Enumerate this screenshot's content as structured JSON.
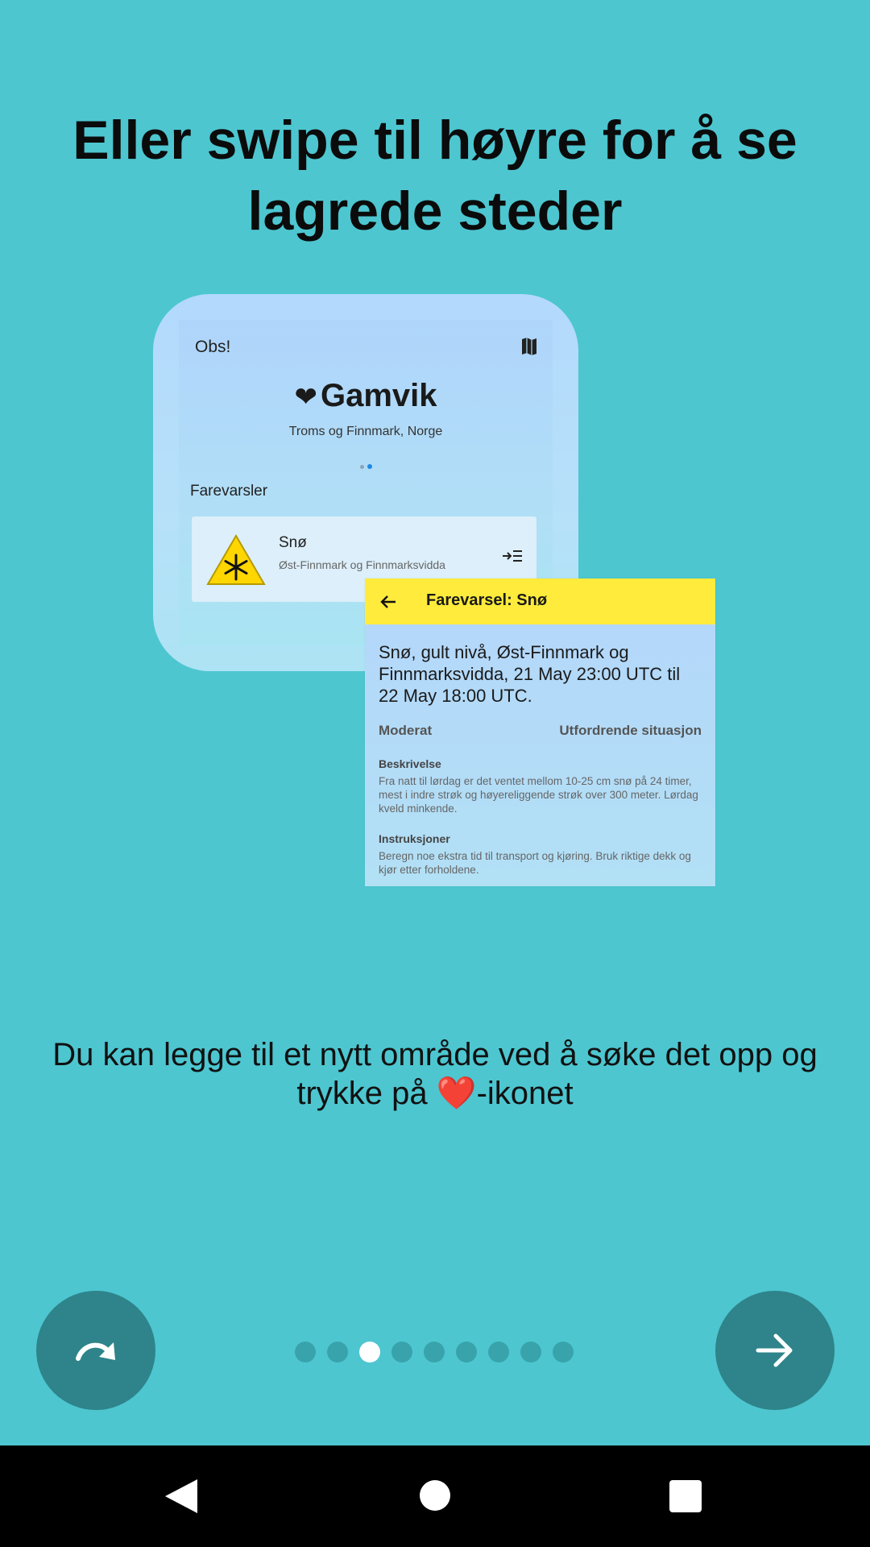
{
  "title": "Eller swipe til høyre for å se lagrede steder",
  "illustration": {
    "location_card": {
      "obs_label": "Obs!",
      "map_icon": "map-icon",
      "heart_symbol": "❤",
      "location_name": "Gamvik",
      "region": "Troms og Finnmark, Norge",
      "section_label": "Farevarsler",
      "warning": {
        "icon": "snowflake-warning-icon",
        "title": "Snø",
        "area": "Øst-Finnmark og Finnmarksvidda"
      }
    },
    "detail_card": {
      "bar_title": "Farevarsel: Snø",
      "headline": "Snø, gult nivå, Øst-Finnmark og Finnmarksvidda, 21 May 23:00 UTC til 22 May 18:00 UTC.",
      "level_left": "Moderat",
      "level_right": "Utfordrende situasjon",
      "description_heading": "Beskrivelse",
      "description_text": "Fra natt til lørdag er det ventet mellom 10-25 cm snø på 24 timer, mest i indre strøk og høyereliggende strøk over 300 meter. Lørdag kveld minkende.",
      "instructions_heading": "Instruksjoner",
      "instructions_text": "Beregn noe ekstra tid til transport og kjøring. Bruk riktige dekk og kjør etter forholdene."
    }
  },
  "body_text": "Du kan legge til et nytt område ved å søke det opp og trykke på ❤️-ikonet",
  "pager": {
    "total": 9,
    "active_index": 2
  },
  "colors": {
    "background": "#4DC6D0",
    "button": "#2E848A",
    "warning_bar": "#FFEB3B"
  },
  "icons": {
    "skip": "skip-redo-icon",
    "next": "arrow-right-icon"
  }
}
